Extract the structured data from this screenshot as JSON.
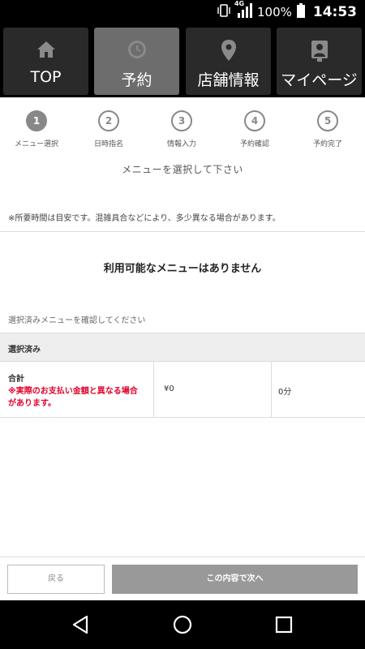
{
  "status": {
    "network": "4G",
    "battery": "100%",
    "time": "14:53"
  },
  "tabs": [
    {
      "label": "TOP",
      "icon": "home-icon",
      "active": false
    },
    {
      "label": "予約",
      "icon": "clock-icon",
      "active": true
    },
    {
      "label": "店舗情報",
      "icon": "map-pin-icon",
      "active": false
    },
    {
      "label": "マイページ",
      "icon": "user-card-icon",
      "active": false
    }
  ],
  "steps": [
    {
      "number": "1",
      "label": "メニュー選択",
      "active": true
    },
    {
      "number": "2",
      "label": "日時指名",
      "active": false
    },
    {
      "number": "3",
      "label": "情報入力",
      "active": false
    },
    {
      "number": "4",
      "label": "予約確認",
      "active": false
    },
    {
      "number": "5",
      "label": "予約完了",
      "active": false
    }
  ],
  "main": {
    "heading": "メニューを選択して下さい",
    "note": "※所要時間は目安です。混雑具合などにより、多少異なる場合があります。",
    "no_menu": "利用可能なメニューはありません",
    "confirm_label": "選択済みメニューを確認してください"
  },
  "selected": {
    "header": "選択済み",
    "total_label": "合計",
    "warning": "※実際のお支払い金額と異なる場合があります。",
    "price": "¥0",
    "duration": "0分"
  },
  "actions": {
    "back_label": "戻る",
    "next_label": "この内容で次へ"
  },
  "colors": {
    "active_tab": "#6d6d6d",
    "warning": "#e0002a",
    "next_button": "#999999"
  }
}
